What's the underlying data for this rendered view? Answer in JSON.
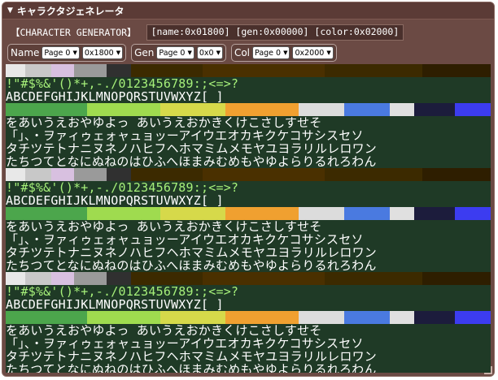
{
  "title": "キャラクタジェネレータ",
  "info": {
    "label": "【CHARACTER GENERATOR】",
    "name": "[name:0x01800]",
    "gen": "[gen:0x00000]",
    "color": "[color:0x02000]"
  },
  "controls": {
    "name": {
      "label": "Name",
      "page": "Page 0",
      "addr": "0x1800"
    },
    "gen": {
      "label": "Gen",
      "page": "Page 0",
      "addr": "0x0"
    },
    "col": {
      "label": "Col",
      "page": "Page 0",
      "addr": "0x2000"
    }
  },
  "rows": {
    "r1": " !\"#$%&'()*+,-./0123456789:;<=>?",
    "r2": "ABCDEFGHIJKLMNOPQRSTUVWXYZ[  ]",
    "r4": "をあいうえおやゆよっ あいうえおかきくけこさしすせそ",
    "r5": "「」、・ヲァィゥェォャュョッーアイウエオカキクケコサシスセソ",
    "r6": "タチツテトナニヌネノハヒフヘホマミムメモヤユヨラリルレロワン",
    "r7": "たちつてとなにぬねのはひふへほまみむめもやゆよらりるれろわん"
  },
  "colors": {
    "background": "#1f3a26",
    "titlebar": "#5b3b36",
    "panel": "#6b4a44"
  }
}
